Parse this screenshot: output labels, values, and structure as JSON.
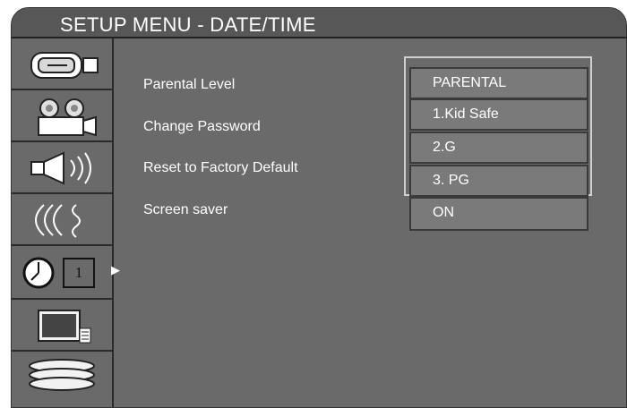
{
  "header": {
    "title": "SETUP MENU - DATE/TIME"
  },
  "sidebar": {
    "tabs": [
      {
        "icon": "video-camera-icon"
      },
      {
        "icon": "film-camera-icon"
      },
      {
        "icon": "speaker-icon"
      },
      {
        "icon": "audio-waves-icon"
      },
      {
        "icon": "clock-calendar-icon",
        "calendar_text": "1"
      },
      {
        "icon": "tv-icon"
      },
      {
        "icon": "stacked-discs-icon"
      }
    ]
  },
  "menu": {
    "items": [
      {
        "label": "Parental Level"
      },
      {
        "label": "Change Password"
      },
      {
        "label": "Reset to Factory Default"
      },
      {
        "label": "Screen saver"
      }
    ]
  },
  "dropdown": {
    "options": [
      "PARENTAL",
      "1.Kid Safe",
      "2.G",
      "3. PG"
    ],
    "screen_saver_value": "ON"
  }
}
